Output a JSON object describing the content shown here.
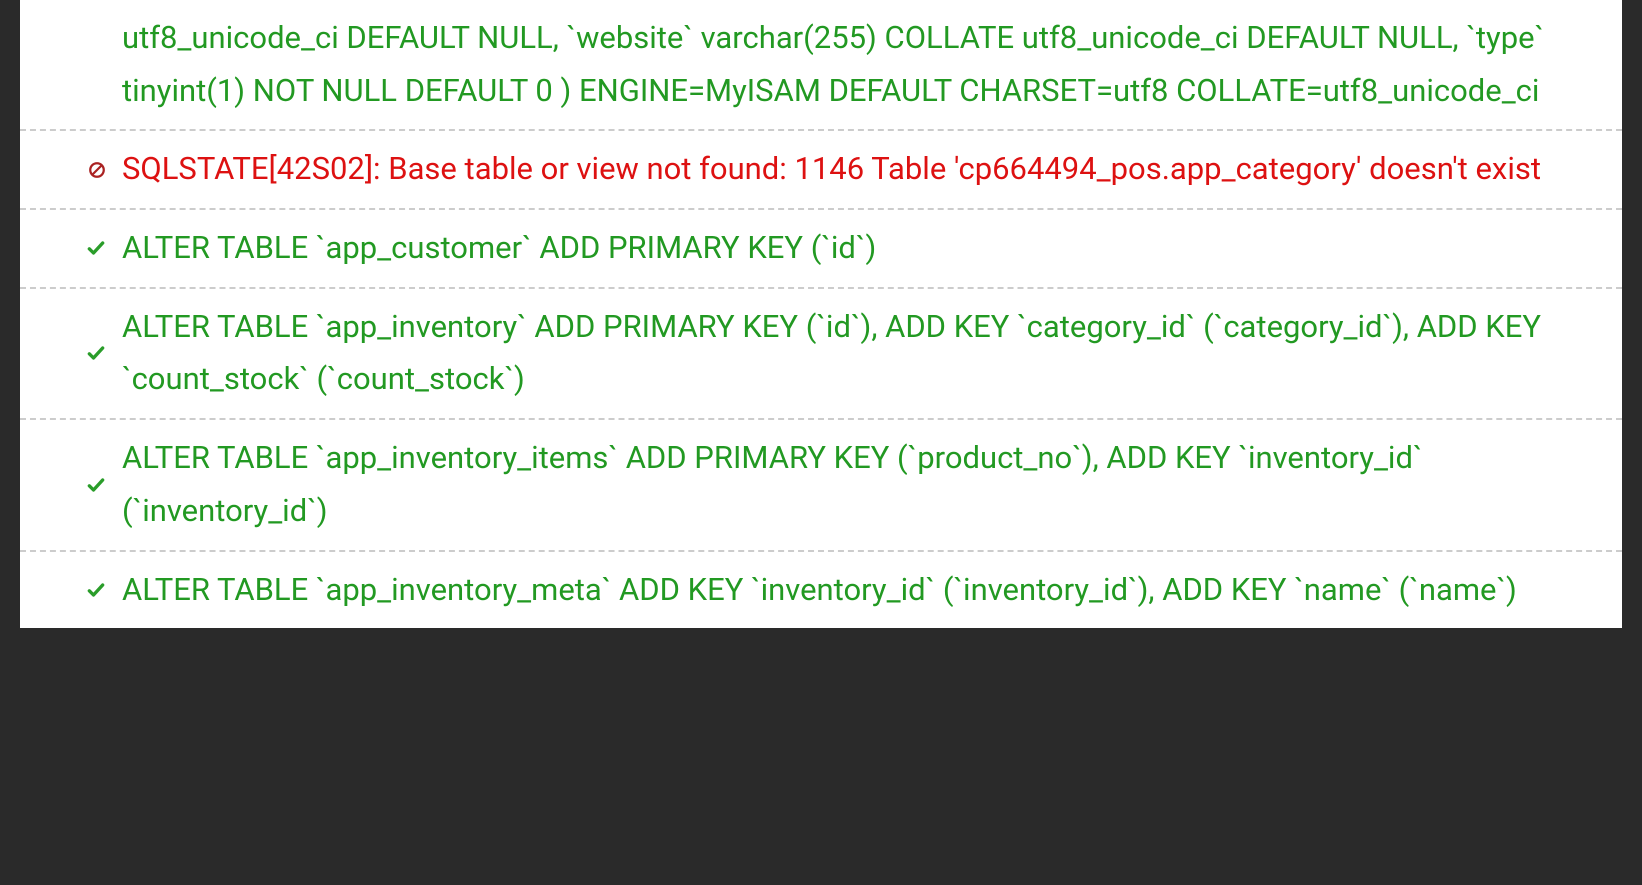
{
  "log": {
    "rows": [
      {
        "status": "success",
        "partial": true,
        "text": "utf8_unicode_ci DEFAULT NULL, `website` varchar(255) COLLATE utf8_unicode_ci DEFAULT NULL, `type` tinyint(1) NOT NULL DEFAULT 0 ) ENGINE=MyISAM DEFAULT CHARSET=utf8 COLLATE=utf8_unicode_ci"
      },
      {
        "status": "error",
        "text": "SQLSTATE[42S02]: Base table or view not found: 1146 Table 'cp664494_pos.app_category' doesn't exist"
      },
      {
        "status": "success",
        "text": "ALTER TABLE `app_customer` ADD PRIMARY KEY (`id`)"
      },
      {
        "status": "success",
        "text": "ALTER TABLE `app_inventory` ADD PRIMARY KEY (`id`), ADD KEY `category_id` (`category_id`), ADD KEY `count_stock` (`count_stock`)"
      },
      {
        "status": "success",
        "text": "ALTER TABLE `app_inventory_items` ADD PRIMARY KEY (`product_no`), ADD KEY `inventory_id` (`inventory_id`)"
      },
      {
        "status": "success",
        "text": "ALTER TABLE `app_inventory_meta` ADD KEY `inventory_id` (`inventory_id`), ADD KEY `name` (`name`)"
      }
    ]
  },
  "colors": {
    "success": "#229922",
    "error": "#dd1111",
    "divider": "#cccccc",
    "panel_bg": "#ffffff",
    "page_bg": "#2a2a2a"
  }
}
